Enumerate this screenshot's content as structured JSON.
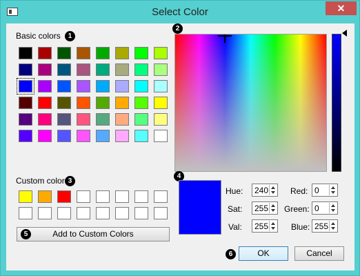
{
  "window": {
    "title": "Select Color",
    "close_symbol": "✕"
  },
  "basic_colors": {
    "label": "Basic colors",
    "marker": "1",
    "selected_index": 16,
    "colors": [
      "#000000",
      "#aa0000",
      "#005500",
      "#aa5500",
      "#00aa00",
      "#aaaa00",
      "#00ff00",
      "#aaff00",
      "#00007f",
      "#aa007f",
      "#00557f",
      "#aa557f",
      "#00aa7f",
      "#aaaa7f",
      "#00ff7f",
      "#aaff7f",
      "#0000ff",
      "#aa00ff",
      "#0055ff",
      "#aa55ff",
      "#00aaff",
      "#aaaaff",
      "#00ffff",
      "#aaffff",
      "#550000",
      "#ff0000",
      "#555500",
      "#ff5500",
      "#55aa00",
      "#ffaa00",
      "#55ff00",
      "#ffff00",
      "#55007f",
      "#ff007f",
      "#55557f",
      "#ff557f",
      "#55aa7f",
      "#ffaa7f",
      "#55ff7f",
      "#ffff7f",
      "#5500ff",
      "#ff00ff",
      "#5555ff",
      "#ff55ff",
      "#55aaff",
      "#ffaaff",
      "#55ffff",
      "#ffffff"
    ]
  },
  "color_picker": {
    "marker": "2"
  },
  "custom_colors": {
    "label": "Custom colors",
    "marker": "3",
    "colors": [
      "#ffff00",
      "#ffaa00",
      "#ff0000",
      "#ffffff",
      "#ffffff",
      "#ffffff",
      "#ffffff",
      "#ffffff",
      "#ffffff",
      "#ffffff",
      "#ffffff",
      "#ffffff",
      "#ffffff",
      "#ffffff",
      "#ffffff",
      "#ffffff"
    ]
  },
  "preview": {
    "marker": "4",
    "color": "#0000ff"
  },
  "add_custom": {
    "marker": "5",
    "label": "Add to Custom Colors"
  },
  "fields": {
    "hue": {
      "label": "Hue:",
      "value": "240"
    },
    "sat": {
      "label": "Sat:",
      "value": "255"
    },
    "val": {
      "label": "Val:",
      "value": "255"
    },
    "red": {
      "label": "Red:",
      "value": "0"
    },
    "green": {
      "label": "Green:",
      "value": "0"
    },
    "blue": {
      "label": "Blue:",
      "value": "255"
    }
  },
  "buttons": {
    "marker": "6",
    "ok": "OK",
    "cancel": "Cancel"
  }
}
